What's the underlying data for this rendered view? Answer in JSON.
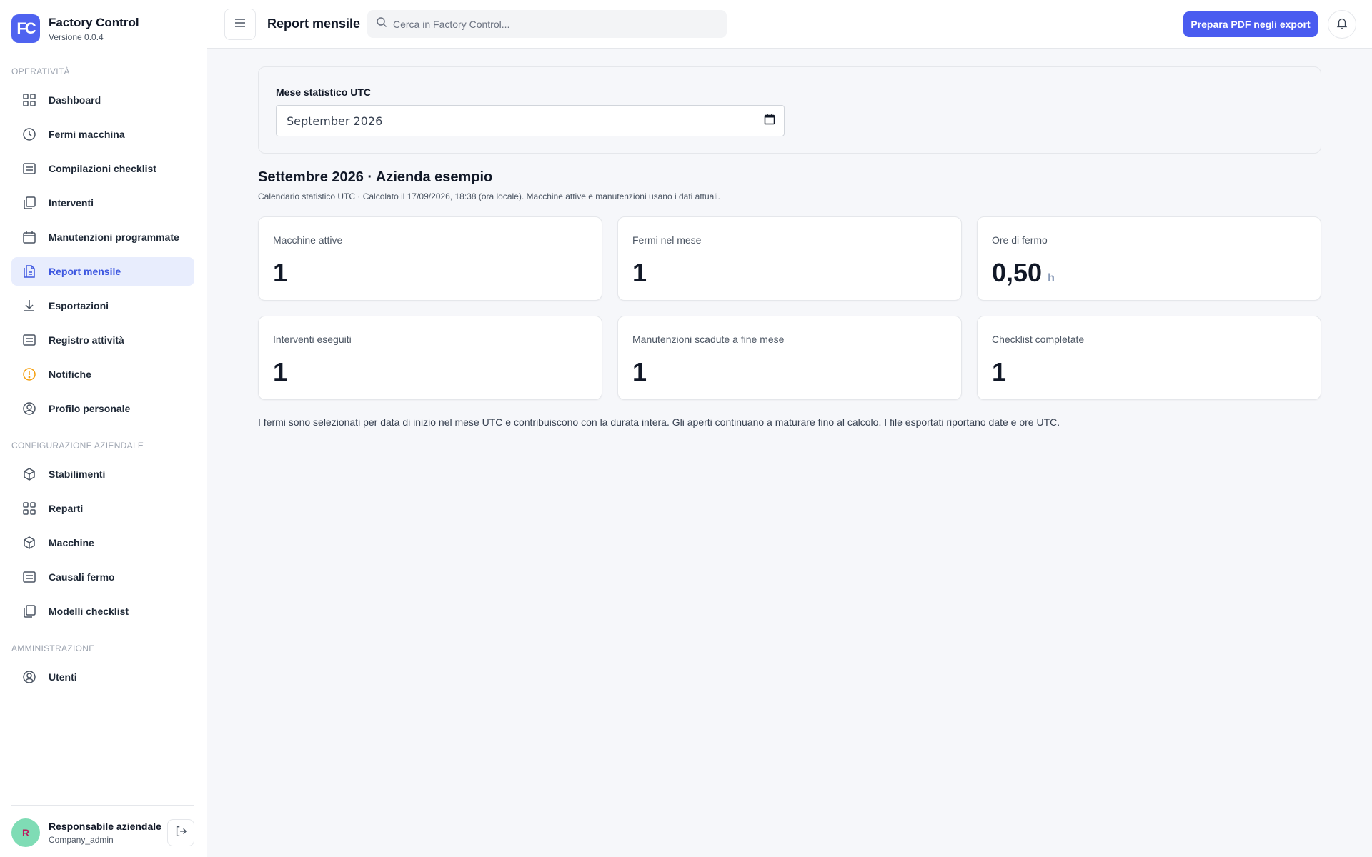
{
  "app": {
    "logo": "FC",
    "name": "Factory Control",
    "version": "Versione 0.0.4"
  },
  "sidebar": {
    "sections": [
      {
        "title": "OPERATIVITÀ",
        "items": [
          {
            "label": "Dashboard",
            "icon": "grid-icon"
          },
          {
            "label": "Fermi macchina",
            "icon": "clock-icon"
          },
          {
            "label": "Compilazioni checklist",
            "icon": "list-icon"
          },
          {
            "label": "Interventi",
            "icon": "copy-icon"
          },
          {
            "label": "Manutenzioni programmate",
            "icon": "calendar-icon"
          },
          {
            "label": "Report mensile",
            "icon": "report-icon",
            "active": true
          },
          {
            "label": "Esportazioni",
            "icon": "download-icon"
          },
          {
            "label": "Registro attività",
            "icon": "list-icon"
          },
          {
            "label": "Notifiche",
            "icon": "info-icon"
          },
          {
            "label": "Profilo personale",
            "icon": "user-icon"
          }
        ]
      },
      {
        "title": "CONFIGURAZIONE AZIENDALE",
        "items": [
          {
            "label": "Stabilimenti",
            "icon": "box-icon"
          },
          {
            "label": "Reparti",
            "icon": "grid-icon"
          },
          {
            "label": "Macchine",
            "icon": "box-icon"
          },
          {
            "label": "Causali fermo",
            "icon": "list-icon"
          },
          {
            "label": "Modelli checklist",
            "icon": "copy-icon"
          }
        ]
      },
      {
        "title": "AMMINISTRAZIONE",
        "items": [
          {
            "label": "Utenti",
            "icon": "user-icon"
          }
        ]
      }
    ]
  },
  "user": {
    "initial": "R",
    "name": "Responsabile aziendale",
    "role": "Company_admin"
  },
  "topbar": {
    "title": "Report mensile",
    "search_placeholder": "Cerca in Factory Control...",
    "pdf_button": "Prepara PDF negli export"
  },
  "filter": {
    "label": "Mese statistico UTC",
    "value": "September 2026"
  },
  "report": {
    "title": "Settembre 2026 · Azienda esempio",
    "subtitle": "Calendario statistico UTC · Calcolato il 17/09/2026, 18:38 (ora locale). Macchine attive e manutenzioni usano i dati attuali.",
    "stats": [
      {
        "label": "Macchine attive",
        "value": "1",
        "unit": ""
      },
      {
        "label": "Fermi nel mese",
        "value": "1",
        "unit": ""
      },
      {
        "label": "Ore di fermo",
        "value": "0,50",
        "unit": "h"
      },
      {
        "label": "Interventi eseguiti",
        "value": "1",
        "unit": ""
      },
      {
        "label": "Manutenzioni scadute a fine mese",
        "value": "1",
        "unit": ""
      },
      {
        "label": "Checklist completate",
        "value": "1",
        "unit": ""
      }
    ],
    "footnote": "I fermi sono selezionati per data di inizio nel mese UTC e contribuiscono con la durata intera. Gli aperti continuano a maturare fino al calcolo. I file esportati riportano date e ore UTC."
  },
  "colors": {
    "accent": "#4a5cf0",
    "active_bg": "#e8edfd",
    "notice_icon": "#f59e0b"
  }
}
